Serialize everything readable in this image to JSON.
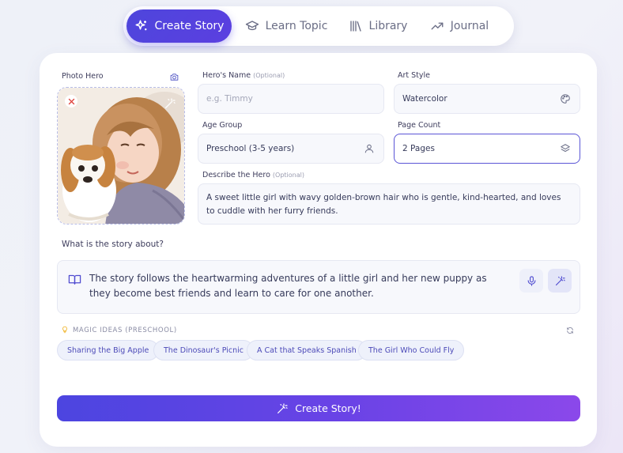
{
  "nav": {
    "items": [
      {
        "label": "Create Story",
        "icon": "sparkles-icon"
      },
      {
        "label": "Learn Topic",
        "icon": "graduation-cap-icon"
      },
      {
        "label": "Library",
        "icon": "library-icon"
      },
      {
        "label": "Journal",
        "icon": "trend-line-icon"
      }
    ],
    "active_index": 0
  },
  "form": {
    "photo_hero_label": "Photo Hero",
    "hero_name": {
      "label": "Hero's Name",
      "optional": "(Optional)",
      "placeholder": "e.g. Timmy"
    },
    "art_style": {
      "label": "Art Style",
      "value": "Watercolor"
    },
    "age_group": {
      "label": "Age Group",
      "value": "Preschool (3-5 years)"
    },
    "page_count": {
      "label": "Page Count",
      "value": "2 Pages"
    },
    "describe_hero": {
      "label": "Describe the Hero",
      "optional": "(Optional)",
      "value": "A sweet little girl with wavy golden-brown hair who is gentle, kind-hearted, and loves to cuddle with her furry friends."
    },
    "story_about": {
      "label": "What is the story about?",
      "value": "The story follows the heartwarming adventures of a little girl and her new puppy as they become best friends and learn to care for one another."
    }
  },
  "magic_ideas": {
    "title": "MAGIC IDEAS (PRESCHOOL)",
    "chips": [
      "Sharing the Big Apple",
      "The Dinosaur's Picnic",
      "A Cat that Speaks Spanish",
      "The Girl Who Could Fly"
    ]
  },
  "cta": {
    "label": "Create Story!"
  },
  "colors": {
    "accent": "#4f46e5",
    "accent_end": "#8b48ea",
    "muted": "#6a6d85"
  }
}
